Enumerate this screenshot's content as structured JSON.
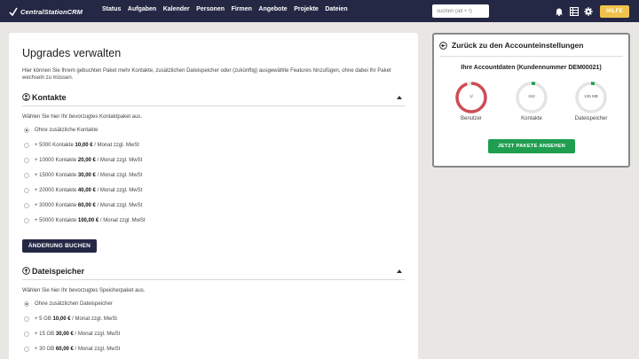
{
  "brand": {
    "name": "CentralStationCRM"
  },
  "nav": [
    "Status",
    "Aufgaben",
    "Kalender",
    "Personen",
    "Firmen",
    "Angebote",
    "Projekte",
    "Dateien"
  ],
  "search": {
    "placeholder": "suchen (alt + f)"
  },
  "topbar_icons": [
    "bell-icon",
    "grid-icon",
    "gear-icon"
  ],
  "help_label": "HILFE",
  "colors": {
    "navbar": "#252845",
    "help": "#f0c24b",
    "gauge_full": "#cf4b55",
    "gauge_ok": "#1f9e50",
    "cta": "#1f9e50"
  },
  "main": {
    "title": "Upgrades verwalten",
    "intro": "Hier können Sie Ihrem gebuchten Paket mehr Kontakte, zusätzlichen Dateispeicher oder (zukünftig) ausgewählte Features hinzufügen, ohne dabei Ihr Paket wechseln zu müssen.",
    "contacts": {
      "title": "Kontakte",
      "hint": "Wählen Sie hier Ihr bevorzugtes Kontaktpaket aus.",
      "options": [
        {
          "text": "Ohne zusätzliche Kontakte",
          "selected": true
        },
        {
          "prefix": "+ 5000 Kontakte ",
          "price": "10,00 €",
          "suffix": " / Monat zzgl. MwSt"
        },
        {
          "prefix": "+ 10000 Kontakte ",
          "price": "20,00 €",
          "suffix": " / Monat zzgl. MwSt"
        },
        {
          "prefix": "+ 15000 Kontakte ",
          "price": "30,00 €",
          "suffix": " / Monat zzgl. MwSt"
        },
        {
          "prefix": "+ 20000 Kontakte ",
          "price": "40,00 €",
          "suffix": " / Monat zzgl. MwSt"
        },
        {
          "prefix": "+ 30000 Kontakte ",
          "price": "60,00 €",
          "suffix": " / Monat zzgl. MwSt"
        },
        {
          "prefix": "+ 50000 Kontakte ",
          "price": "100,00 €",
          "suffix": " / Monat zzgl. MwSt"
        }
      ],
      "button": "ÄNDERUNG BUCHEN"
    },
    "storage": {
      "title": "Dateispeicher",
      "hint": "Wählen Sie hier Ihr bevorzugtes Speicherpaket aus.",
      "options": [
        {
          "text": "Ohne zusätzlichen Dateispeicher",
          "selected": true
        },
        {
          "prefix": "+ 5 GB ",
          "price": "10,00 €",
          "suffix": " / Monat zzgl. MwSt"
        },
        {
          "prefix": "+ 15 GB ",
          "price": "30,00 €",
          "suffix": " / Monat zzgl. MwSt"
        },
        {
          "prefix": "+ 30 GB ",
          "price": "60,00 €",
          "suffix": " / Monat zzgl. MwSt"
        }
      ]
    }
  },
  "side": {
    "back_label": "Zurück zu den Accounteinstellungen",
    "account_label": "Ihre Accountdaten (Kundennummer DEM00021)",
    "gauges": [
      {
        "label": "Benutzer",
        "value": "1/",
        "fill": 0.95,
        "color": "#cf4b55"
      },
      {
        "label": "Kontakte",
        "value": "342",
        "fill": 0.04,
        "color": "#1f9e50"
      },
      {
        "label": "Dateispeicher",
        "value": "135 MB",
        "fill": 0.04,
        "color": "#1f9e50"
      }
    ],
    "cta": "JETZT PAKETE ANSEHEN"
  }
}
